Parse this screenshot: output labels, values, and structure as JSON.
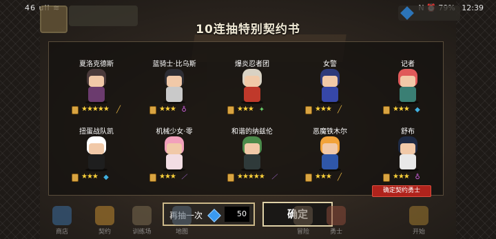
{
  "status_bar": {
    "left": "46 ull ≋",
    "right_icons": "N ⏰ 79%",
    "time": "12:39"
  },
  "dialog": {
    "title": "10连抽特别契约书",
    "heroes": [
      {
        "name": "夏洛克德斯",
        "stars": "★★★★★",
        "weapon_icon": "wand-icon",
        "colors": {
          "hair": "#4a3a3a",
          "body": "#6b3b6e"
        }
      },
      {
        "name": "蓝骑士·比乌斯",
        "stars": "★★★",
        "weapon_icon": "ring-icon",
        "colors": {
          "hair": "#2d2d33",
          "body": "#c9c9c9"
        }
      },
      {
        "name": "爆炎忍者团",
        "stars": "★★★",
        "weapon_icon": "shuriken-icon",
        "colors": {
          "hair": "#d9d2c4",
          "body": "#c0392b"
        }
      },
      {
        "name": "女警",
        "stars": "★★★",
        "weapon_icon": "baton-icon",
        "colors": {
          "hair": "#2e3a7a",
          "body": "#3647a8"
        }
      },
      {
        "name": "记者",
        "stars": "★★★",
        "weapon_icon": "gem-icon",
        "colors": {
          "hair": "#e05a5a",
          "body": "#3a7f74"
        }
      },
      {
        "name": "扭蛋战队凯",
        "stars": "★★★",
        "weapon_icon": "gem-icon",
        "colors": {
          "hair": "#ffffff",
          "body": "#1e1e1e"
        }
      },
      {
        "name": "机械少女·零",
        "stars": "★★★",
        "weapon_icon": "staff-icon",
        "colors": {
          "hair": "#f2a0bb",
          "body": "#f2dde3"
        }
      },
      {
        "name": "和谐的纳兹伦",
        "stars": "★★★★★",
        "weapon_icon": "staff-icon",
        "colors": {
          "hair": "#4b8a4a",
          "body": "#2f3a3a"
        }
      },
      {
        "name": "恶魔铁木尔",
        "stars": "★★★",
        "weapon_icon": "baton-icon",
        "colors": {
          "hair": "#f2a33a",
          "body": "#2f57a8"
        }
      },
      {
        "name": "舒布",
        "stars": "★★★",
        "weapon_icon": "ring-icon",
        "colors": {
          "hair": "#1e2a44",
          "body": "#e8e8e8"
        }
      }
    ],
    "confirm_tag": "确定契约勇士"
  },
  "buttons": {
    "again_label": "再抽一次",
    "again_cost": "50",
    "ok_label": "确定"
  },
  "nav": [
    "商店",
    "契约",
    "训练场",
    "地图",
    "冒险",
    "勇士",
    "开始"
  ],
  "accent": {
    "gem": "#3a9af0",
    "star": "#ffd23a",
    "tag": "#b0231c"
  }
}
